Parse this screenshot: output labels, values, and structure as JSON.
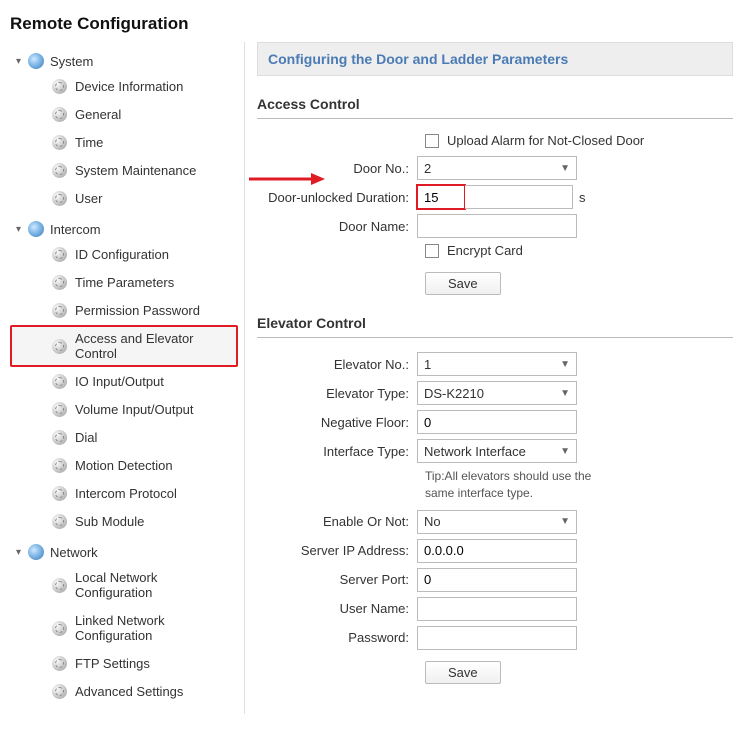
{
  "page_title": "Remote Configuration",
  "panel_title": "Configuring the Door and Ladder Parameters",
  "sidebar": {
    "groups": [
      {
        "label": "System",
        "items": [
          {
            "label": "Device Information"
          },
          {
            "label": "General"
          },
          {
            "label": "Time"
          },
          {
            "label": "System Maintenance"
          },
          {
            "label": "User"
          }
        ]
      },
      {
        "label": "Intercom",
        "items": [
          {
            "label": "ID Configuration"
          },
          {
            "label": "Time Parameters"
          },
          {
            "label": "Permission Password"
          },
          {
            "label": "Access and Elevator Control",
            "selected": true
          },
          {
            "label": "IO Input/Output"
          },
          {
            "label": "Volume Input/Output"
          },
          {
            "label": "Dial"
          },
          {
            "label": "Motion Detection"
          },
          {
            "label": "Intercom Protocol"
          },
          {
            "label": "Sub Module"
          }
        ]
      },
      {
        "label": "Network",
        "items": [
          {
            "label": "Local Network Configuration"
          },
          {
            "label": "Linked Network Configuration"
          },
          {
            "label": "FTP Settings"
          },
          {
            "label": "Advanced Settings"
          }
        ]
      }
    ]
  },
  "access": {
    "title": "Access Control",
    "upload_alarm_label": "Upload Alarm for Not-Closed Door",
    "door_no_label": "Door No.:",
    "door_no_value": "2",
    "duration_label": "Door-unlocked Duration:",
    "duration_value": "15",
    "duration_unit": "s",
    "door_name_label": "Door Name:",
    "door_name_value": "",
    "encrypt_label": "Encrypt Card",
    "save_label": "Save"
  },
  "elevator": {
    "title": "Elevator Control",
    "no_label": "Elevator No.:",
    "no_value": "1",
    "type_label": "Elevator Type:",
    "type_value": "DS-K2210",
    "neg_floor_label": "Negative Floor:",
    "neg_floor_value": "0",
    "iface_label": "Interface Type:",
    "iface_value": "Network Interface",
    "tip": "Tip:All elevators should use the same interface type.",
    "enable_label": "Enable Or Not:",
    "enable_value": "No",
    "server_ip_label": "Server IP Address:",
    "server_ip_value": "0.0.0.0",
    "server_port_label": "Server Port:",
    "server_port_value": "0",
    "user_label": "User Name:",
    "user_value": "",
    "pwd_label": "Password:",
    "pwd_value": "",
    "save_label": "Save"
  }
}
